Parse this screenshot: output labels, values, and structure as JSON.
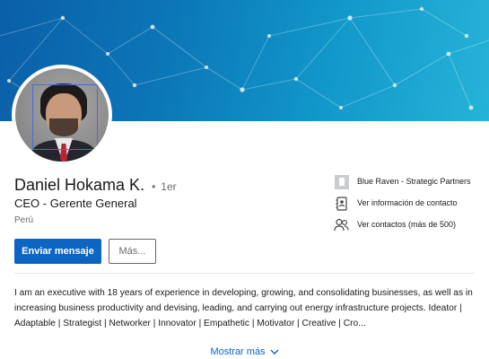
{
  "profile": {
    "name": "Daniel Hokama K.",
    "separator": "•",
    "degree": "1er",
    "headline": "CEO - Gerente General",
    "location": "Perú"
  },
  "actions": {
    "message_label": "Enviar mensaje",
    "more_label": "Más..."
  },
  "sidebar": {
    "company": "Blue Raven - Strategic Partners",
    "contact_info": "Ver información de contacto",
    "connections": "Ver contactos (más de 500)"
  },
  "about": {
    "text": "I am an executive with 18 years of experience in developing, growing, and consolidating businesses, as well as in increasing business productivity and devising, leading, and carrying out energy infrastructure projects. Ideator | Adaptable | Strategist | Networker | Innovator | Empathetic | Motivator | Creative | Cro..."
  },
  "show_more": {
    "label": "Mostrar más"
  },
  "colors": {
    "primary": "#0a66c2",
    "banner_start": "#0b5fa8",
    "banner_end": "#26b3d8"
  },
  "icons": {
    "company": "company-logo-icon",
    "contact": "contact-card-icon",
    "connections": "people-icon",
    "chevron": "chevron-down-icon"
  }
}
